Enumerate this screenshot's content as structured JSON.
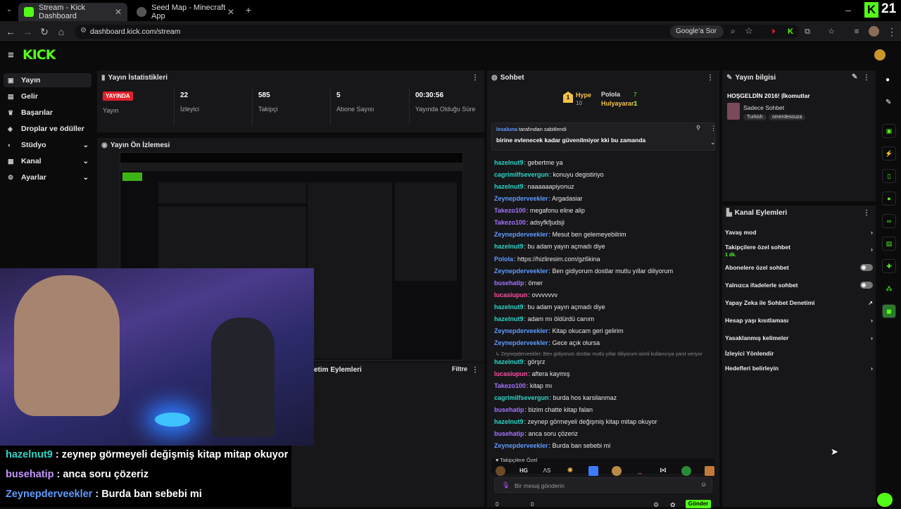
{
  "browser": {
    "tabs": [
      {
        "title": "Stream - Kick Dashboard"
      },
      {
        "title": "Seed Map - Minecraft App"
      }
    ],
    "url": "dashboard.kick.com/stream",
    "lens_label": "Google'a Sor",
    "corner_badge": "21"
  },
  "kick": {
    "logo": "KICK"
  },
  "sidebar": {
    "items": [
      {
        "label": "Yayın"
      },
      {
        "label": "Gelir"
      },
      {
        "label": "Başarılar"
      },
      {
        "label": "Droplar ve ödüller"
      },
      {
        "label": "Stüdyo"
      },
      {
        "label": "Kanal"
      },
      {
        "label": "Ayarlar"
      }
    ]
  },
  "stats": {
    "title": "Yayın İstatistikleri",
    "live_badge": "YAYINDA",
    "items": [
      {
        "value": "",
        "label": "Yayın"
      },
      {
        "value": "22",
        "label": "İzleyici"
      },
      {
        "value": "585",
        "label": "Takipçi"
      },
      {
        "value": "5",
        "label": "Abone Sayısı"
      },
      {
        "value": "00:30:56",
        "label": "Yayında Olduğu Süre"
      }
    ]
  },
  "preview": {
    "title": "Yayın Ön İzlemesi"
  },
  "actions": {
    "title": "etim Eylemleri",
    "filter": "Filtre"
  },
  "overlay_chat": [
    {
      "user": "hazelnut9",
      "text": " : zeynep görmeyeli değişmiş kitap mitap okuyor",
      "color": "#2fd5c6"
    },
    {
      "user": "busehatip",
      "text": " : anca soru çözeriz",
      "color": "#c394ff"
    },
    {
      "user": "Zeynepderveekler",
      "text": " : Burda ban sebebi mi",
      "color": "#5f9bff"
    }
  ],
  "chat": {
    "title": "Sohbet",
    "hype": {
      "label": "Hype",
      "count": "10",
      "top1": "Polola",
      "top1_count": "7",
      "top2": "Hulyayarar1",
      "top2_count": "2"
    },
    "pinned": {
      "by": "lexaluna",
      "by_suffix": " tarafından sabitlendi",
      "text": "birine evlenecek kadar güvenilmiyor kki bu zamanda"
    },
    "messages": [
      {
        "user": "hazelnut9",
        "text": ": gebertme ya",
        "cls": "cyan"
      },
      {
        "user": "cagrimilfsevergun",
        "text": ": konuyu degistiriyo",
        "cls": "cyan"
      },
      {
        "user": "hazelnut9",
        "text": ": naaaaaapiyonuz",
        "cls": "cyan"
      },
      {
        "user": "Zeynepderveekler",
        "text": ": Argadasiar",
        "cls": "blue"
      },
      {
        "user": "Takezo100",
        "text": ": megafonu eline alip",
        "cls": "purp"
      },
      {
        "user": "Takezo100",
        "text": ": adsyfkfjudsji",
        "cls": "purp"
      },
      {
        "user": "Zeynepderveekler",
        "text": ": Mesut ben gelemeyebilrim",
        "cls": "blue"
      },
      {
        "user": "hazelnut9",
        "text": ": bu adam yayın açmadı diye",
        "cls": "cyan"
      },
      {
        "user": "Polola",
        "text": ": https://hizliresim.com/gz6kina",
        "cls": "blue"
      },
      {
        "user": "Zeynepderveekler",
        "text": ": Ben gidiyorum dostlar mutlu yıllar diliyorum",
        "cls": "blue"
      },
      {
        "user": "busehatip",
        "text": ": ömer",
        "cls": "purp"
      },
      {
        "user": "lucasiupun",
        "text": ": ovvvvvvv",
        "cls": "pink"
      },
      {
        "user": "hazelnut9",
        "text": ": bu adam yayın açmadı diye",
        "cls": "cyan"
      },
      {
        "user": "hazelnut9",
        "text": ": adam mı öldürdü canım",
        "cls": "cyan"
      },
      {
        "user": "Zeynepderveekler",
        "text": ": Kitap okucam geri gelirim",
        "cls": "blue"
      },
      {
        "user": "Zeynepderveekler",
        "text": ": Gece açık olursa",
        "cls": "blue"
      },
      {
        "user": "hazelnut9",
        "text": ": görşrz",
        "cls": "cyan"
      },
      {
        "user": "lucasiupun",
        "text": ": aftera kaymış",
        "cls": "pink"
      },
      {
        "user": "Takezo100",
        "text": ": kitap mı",
        "cls": "purp"
      },
      {
        "user": "cagrimilfsevergun",
        "text": ": burda hos karsilanmaz",
        "cls": "cyan"
      },
      {
        "user": "busehatip",
        "text": ": bizim chatte kitap falan",
        "cls": "purp"
      },
      {
        "user": "hazelnut9",
        "text": ": zeynep görmeyeli değişmiş kitap mitap okuyor",
        "cls": "cyan"
      },
      {
        "user": "busehatip",
        "text": ": anca soru çözeriz",
        "cls": "purp"
      },
      {
        "user": "Zeynepderveekler",
        "text": ": Burda ban sebebi mi",
        "cls": "blue"
      }
    ],
    "reply_note": "↳ Zeynepderveekler: Ben gidiyorum dostlar mutlu yıllar diliyorum isimli kullanıcıya yanıt veriyor",
    "followers_label": "Takipçilere Özel",
    "input_placeholder": "Bir mesaj gönderin",
    "send_label": "Gönder",
    "footer_counts": [
      "0",
      "0"
    ]
  },
  "stream_info": {
    "title": "Yayın bilgisi",
    "stream_title": "HOŞGELDİN 2016! |İkomutlar",
    "category": "Sadece Sohbet",
    "tags": [
      "Turkish",
      "omerdesouza"
    ]
  },
  "channel_actions": {
    "title": "Kanal Eylemleri",
    "items": [
      {
        "label": "Yavaş mod",
        "sub": ""
      },
      {
        "label": "Takipçilere özel sohbet",
        "sub": "1 dk."
      },
      {
        "label": "Abonelere özel sohbet",
        "sub": ""
      },
      {
        "label": "Yalnızca ifadelerle sohbet",
        "sub": ""
      },
      {
        "label": "Yapay Zeka ile Sohbet Denetimi",
        "sub": ""
      },
      {
        "label": "Hesap yaşı kısıtlaması",
        "sub": ""
      },
      {
        "label": "Yasaklanmış kelimeler",
        "sub": ""
      },
      {
        "label": "İzleyici Yönlendir",
        "sub": ""
      },
      {
        "label": "Hedefleri belirleyin",
        "sub": ""
      }
    ]
  },
  "colors": {
    "kick_green": "#53fc18",
    "live_red": "#e0202a"
  }
}
